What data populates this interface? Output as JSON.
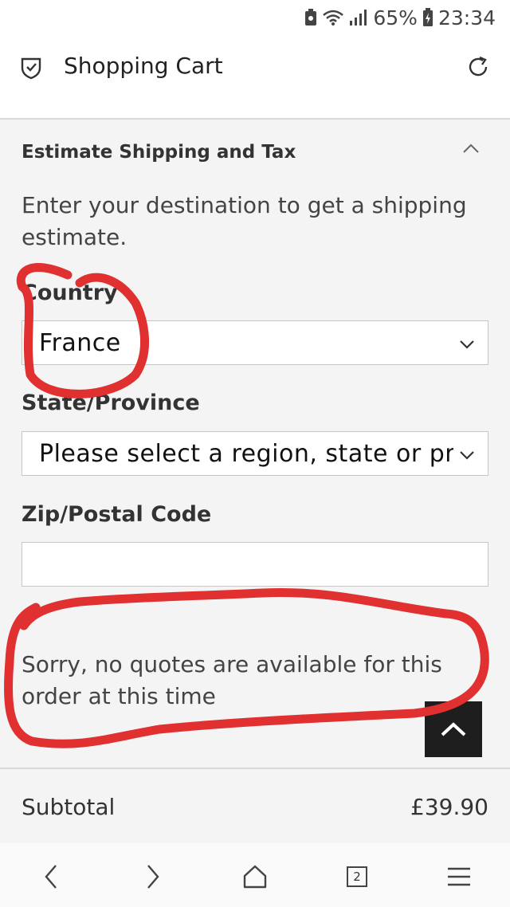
{
  "status_bar": {
    "battery": "65%",
    "time": "23:34"
  },
  "app_bar": {
    "title": "Shopping Cart"
  },
  "estimate": {
    "title": "Estimate Shipping and Tax",
    "intro": "Enter your destination to get a shipping estimate.",
    "country_label": "Country",
    "country_value": "France",
    "state_label": "State/Province",
    "state_value": "Please select a region, state or province.",
    "zip_label": "Zip/Postal Code",
    "zip_value": "",
    "message": "Sorry, no quotes are available for this order at this time"
  },
  "totals": {
    "subtotal_label": "Subtotal",
    "subtotal_value": "£39.90"
  },
  "nav": {
    "tab_count": "2"
  },
  "annotation_color": "#e03030"
}
